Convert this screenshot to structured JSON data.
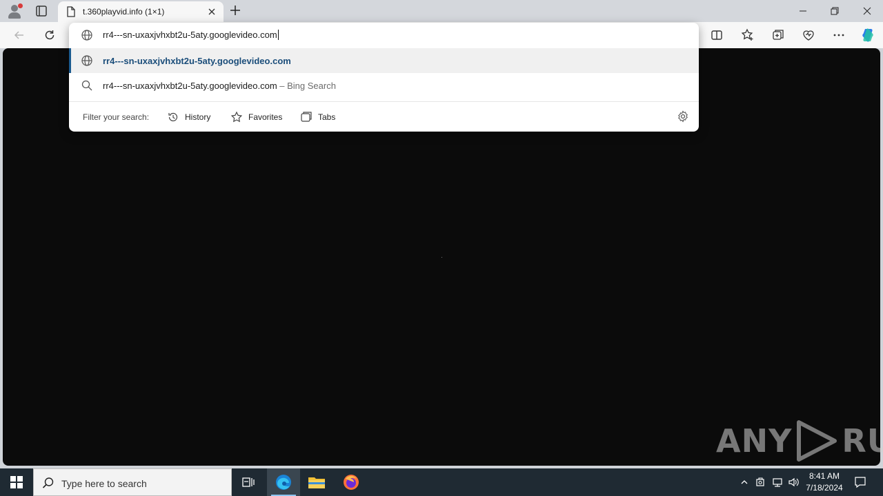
{
  "browser": {
    "tab": {
      "title": "t.360playvid.info (1×1)"
    }
  },
  "omnibox": {
    "input_value": "rr4---sn-uxaxjvhxbt2u-5aty.googlevideo.com",
    "suggestions": [
      {
        "text": "rr4---sn-uxaxjvhxbt2u-5aty.googlevideo.com",
        "suffix": "",
        "icon": "globe-icon"
      },
      {
        "text": "rr4---sn-uxaxjvhxbt2u-5aty.googlevideo.com",
        "suffix": " – Bing Search",
        "icon": "search-icon"
      }
    ],
    "filter": {
      "label": "Filter your search:",
      "chips": [
        "History",
        "Favorites",
        "Tabs"
      ]
    }
  },
  "watermark": {
    "left": "ANY",
    "right": "RUN"
  },
  "taskbar": {
    "search_placeholder": "Type here to search",
    "time": "8:41 AM",
    "date": "7/18/2024"
  },
  "colors": {
    "accent": "#1a5a8f",
    "page_background": "#0b0b0b",
    "taskbar": "#1f2a33"
  }
}
